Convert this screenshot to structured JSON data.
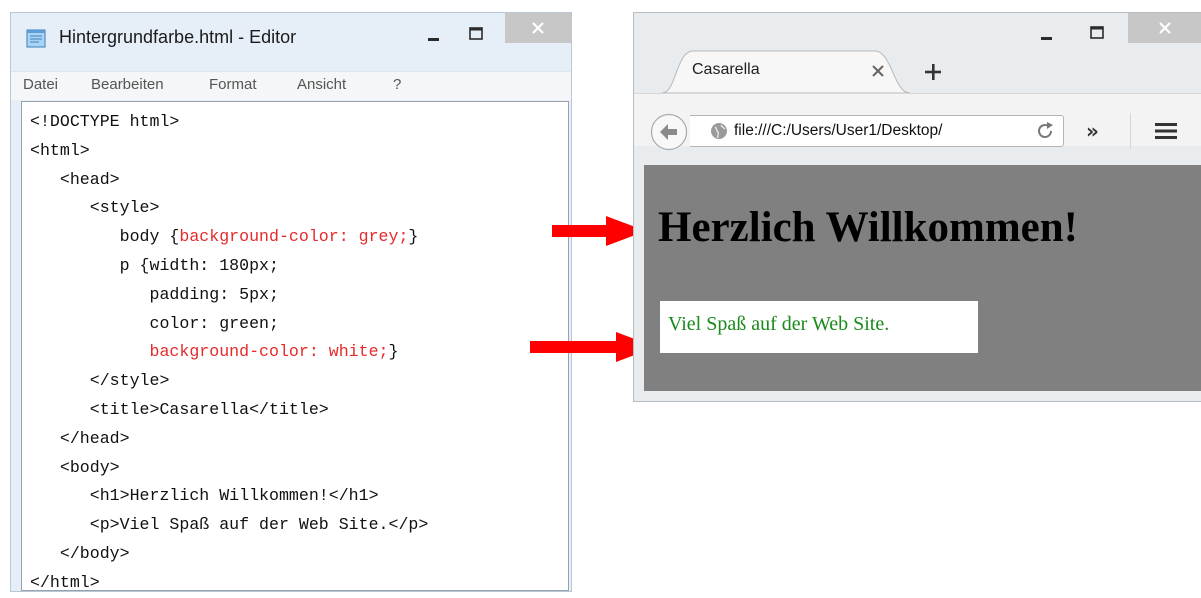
{
  "editor": {
    "title": "Hintergrundfarbe.html - Editor",
    "menu": [
      "Datei",
      "Bearbeiten",
      "Format",
      "Ansicht",
      "?"
    ],
    "code": {
      "l1": "<!DOCTYPE html>",
      "l2": "<html>",
      "l3": "   <head>",
      "l4": "      <style>",
      "l5_pre": "         body {",
      "l5_red": "background-color: grey;",
      "l5_post": "}",
      "l6": "         p {width: 180px;",
      "l7": "            padding: 5px;",
      "l8": "            color: green;",
      "l9_pre": "            ",
      "l9_red": "background-color: white;",
      "l9_post": "}",
      "l10": "      </style>",
      "l11": "      <title>Casarella</title>",
      "l12": "   </head>",
      "l13": "   <body>",
      "l14": "      <h1>Herzlich Willkommen!</h1>",
      "l15": "      <p>Viel Spaß auf der Web Site.</p>",
      "l16": "   </body>",
      "l17": "</html>"
    }
  },
  "browser": {
    "tab_title": "Casarella",
    "url": "file:///C:/Users/User1/Desktop/",
    "more_glyph": "»",
    "heading": "Herzlich Willkommen!",
    "paragraph": "Viel Spaß auf der Web Site."
  },
  "colors": {
    "arrow": "#ff0000",
    "highlight_text": "#e52b2b",
    "page_background": "#808080",
    "paragraph_text": "#1a8a1a"
  },
  "icons": [
    "notepad-icon",
    "minimize-icon",
    "maximize-icon",
    "close-icon",
    "tab-close-icon",
    "new-tab-icon",
    "back-icon",
    "globe-icon",
    "reload-icon",
    "overflow-icon",
    "hamburger-menu-icon",
    "arrow-icon"
  ]
}
